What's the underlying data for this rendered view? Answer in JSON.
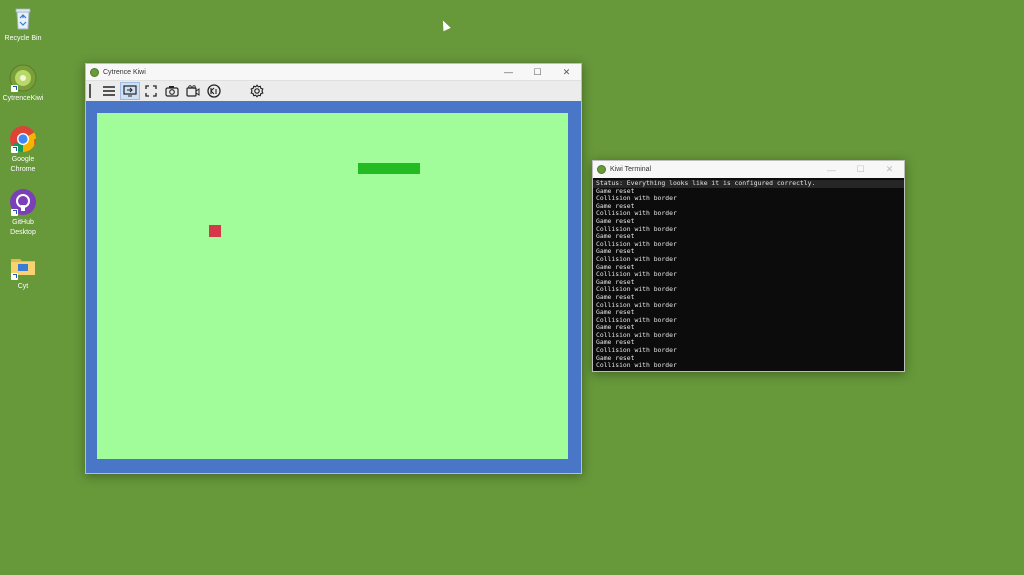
{
  "desktop": {
    "background_color": "#67983a",
    "icons": [
      {
        "label": "Recycle Bin",
        "icon": "recycle-bin-icon"
      },
      {
        "label": "CytrenceKiwi",
        "icon": "kiwi-icon"
      },
      {
        "label": "Google Chrome",
        "icon": "chrome-icon"
      },
      {
        "label": "GitHub Desktop",
        "icon": "github-icon"
      },
      {
        "label": "Cyt",
        "icon": "folder-icon"
      }
    ]
  },
  "game_window": {
    "title": "Cytrence Kiwi",
    "controls": {
      "minimize": "—",
      "maximize": "☐",
      "close": "✕"
    },
    "toolbar": [
      "menu-icon",
      "screen-share-icon",
      "fullscreen-icon",
      "screenshot-icon",
      "record-icon",
      "kiwi-logo-icon",
      "settings-icon"
    ],
    "colors": {
      "border": "#4a76c8",
      "field": "#a1fc9a",
      "paddle": "#22bb22",
      "ball": "#d63848"
    }
  },
  "terminal": {
    "title": "Kiwi Terminal",
    "status": "Status: Everything looks like it is configured correctly.",
    "lines": [
      "Game reset",
      "Collision with border",
      "Game reset",
      "Collision with border",
      "Game reset",
      "Collision with border",
      "Game reset",
      "Collision with border",
      "Game reset",
      "Collision with border",
      "Game reset",
      "Collision with border",
      "Game reset",
      "Collision with border",
      "Game reset",
      "Collision with border",
      "Game reset",
      "Collision with border",
      "Game reset",
      "Collision with border",
      "Game reset",
      "Collision with border",
      "Game reset",
      "Collision with border",
      "Game reset"
    ]
  }
}
